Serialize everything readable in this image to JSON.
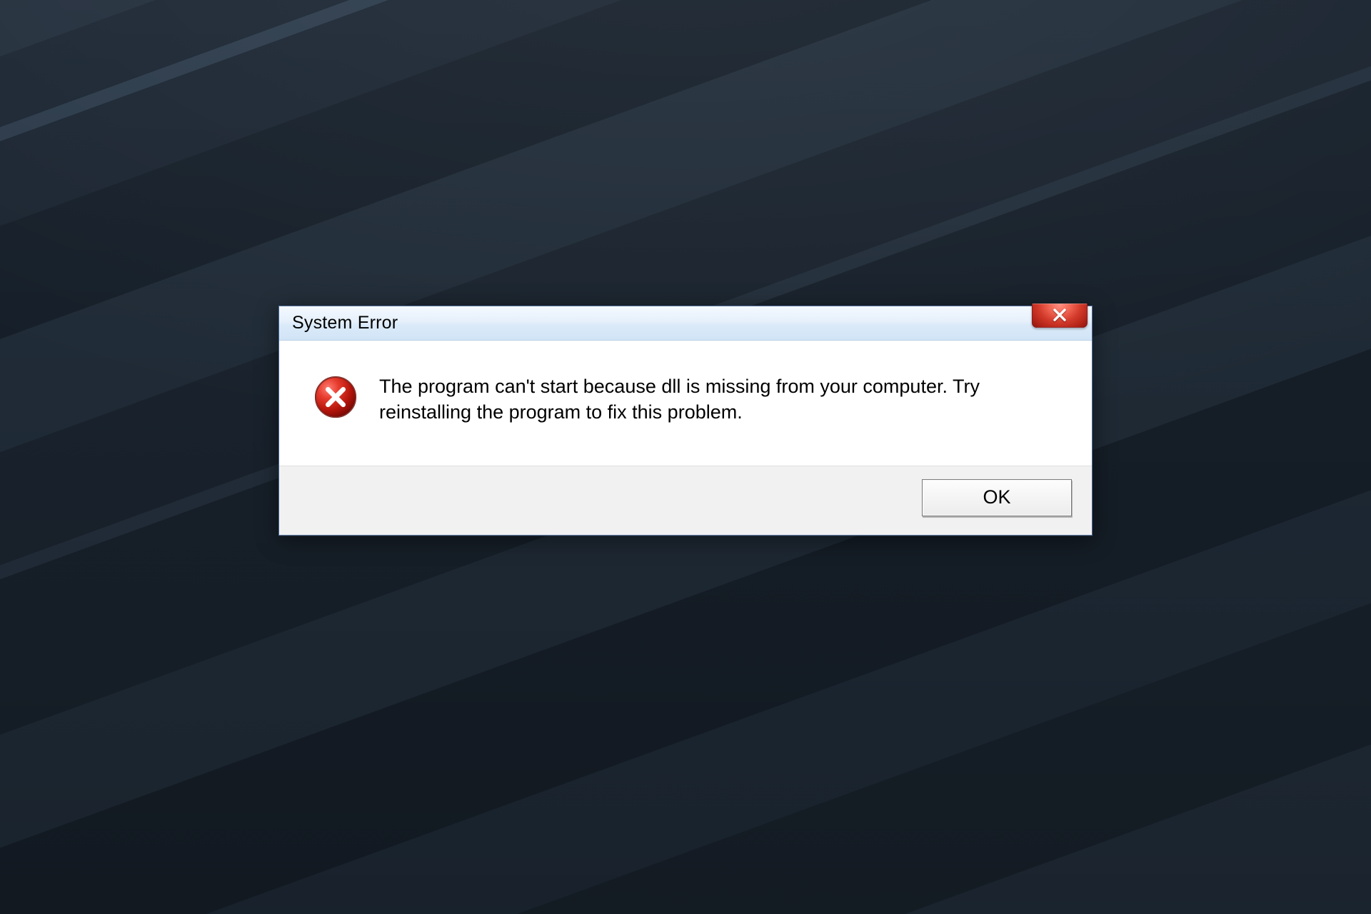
{
  "dialog": {
    "title": "System Error",
    "message": "The program can't start because            dll is missing from your computer. Try reinstalling the program to fix this problem.",
    "ok_label": "OK"
  }
}
